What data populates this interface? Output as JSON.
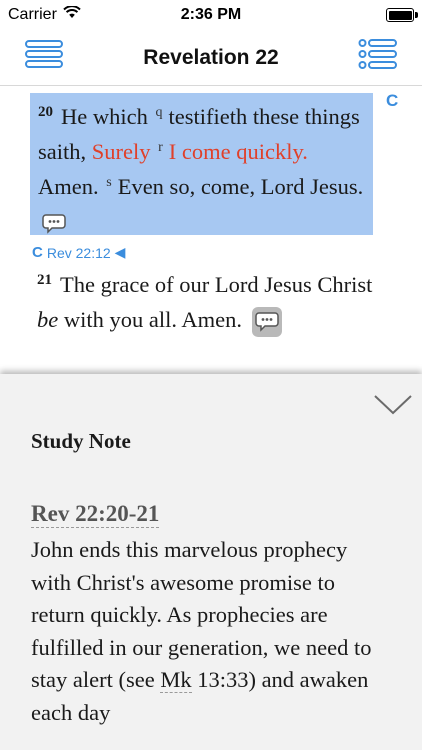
{
  "status_bar": {
    "carrier": "Carrier",
    "time": "2:36 PM"
  },
  "nav": {
    "title": "Revelation 22"
  },
  "bible": {
    "verse20": {
      "number": "20",
      "p1": "He which",
      "ref_q": "q",
      "p2": "testifieth these things saith,",
      "red1": "Surely",
      "ref_r": "r",
      "red2": "I come quickly.",
      "p3": "Amen.",
      "ref_s": "s",
      "p4": "Even so, come, Lord Jesus."
    },
    "c_marker": "C",
    "crossref": {
      "marker": "C",
      "text": "Rev 22:12",
      "arrow": "◀"
    },
    "verse21": {
      "number": "21",
      "p1": "The grace of our Lord Jesus Christ",
      "italic": "be",
      "p2": "with you all. Amen."
    }
  },
  "study_note": {
    "heading": "Study Note",
    "ref": "Rev 22:20-21",
    "body": "John ends this marvelous prophecy with Christ's awesome promise to return quickly. As prophecies are fulfilled in our generation, we need to stay alert (see",
    "link": "Mk",
    "tail": "13:33) and awaken each day"
  },
  "colors": {
    "highlight": "#a7c8f2",
    "accent": "#3b8ddd",
    "red_letter": "#e0402a",
    "panel": "#f2f2f2"
  },
  "icons": {
    "menu": "hamburger-menu-icon",
    "list": "bullet-list-icon",
    "close": "chevron-down-icon",
    "comment": "speech-bubble-icon"
  }
}
